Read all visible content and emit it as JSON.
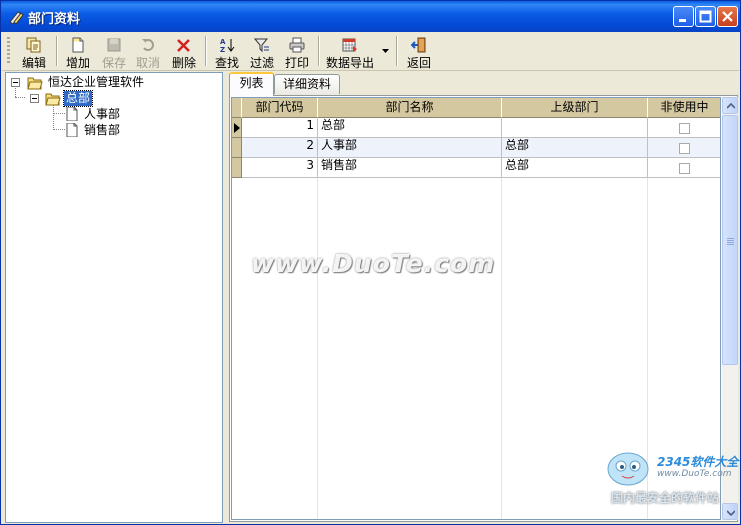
{
  "window": {
    "title": "部门资料"
  },
  "toolbar": {
    "edit": "编辑",
    "add": "增加",
    "save": "保存",
    "cancel": "取消",
    "delete": "删除",
    "find": "查找",
    "filter": "过滤",
    "print": "打印",
    "export": "数据导出",
    "back": "返回"
  },
  "tree": {
    "root": "恒达企业管理软件",
    "head": "总部",
    "children": [
      "人事部",
      "销售部"
    ]
  },
  "tabs": [
    "列表",
    "详细资料"
  ],
  "grid": {
    "columns": [
      "部门代码",
      "部门名称",
      "上级部门",
      "非使用中"
    ],
    "rows": [
      {
        "code": "1",
        "name": "总部",
        "parent": "",
        "inactive": false
      },
      {
        "code": "2",
        "name": "人事部",
        "parent": "总部",
        "inactive": false
      },
      {
        "code": "3",
        "name": "销售部",
        "parent": "总部",
        "inactive": false
      }
    ]
  },
  "watermark": {
    "text": "www.DuoTe.com",
    "brand": "2345软件大全",
    "url": "www.DuoTe.com",
    "slogan": "国内最安全的软件站"
  },
  "colors": {
    "title_bar": "#0b5ce6",
    "header": "#d4c8a0",
    "selection": "#316ac5"
  }
}
